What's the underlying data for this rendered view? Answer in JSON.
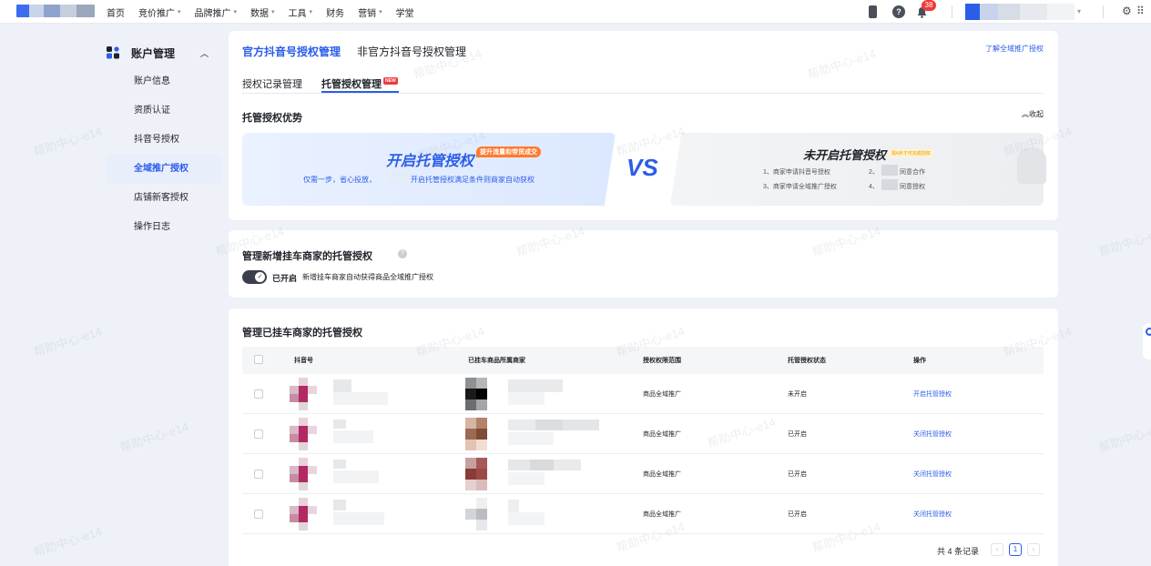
{
  "nav": {
    "items": [
      {
        "label": "首页",
        "caret": false
      },
      {
        "label": "竞价推广",
        "caret": true
      },
      {
        "label": "品牌推广",
        "caret": true
      },
      {
        "label": "数据",
        "caret": true
      },
      {
        "label": "工具",
        "caret": true
      },
      {
        "label": "财务",
        "caret": false
      },
      {
        "label": "营销",
        "caret": true
      },
      {
        "label": "学堂",
        "caret": false
      }
    ],
    "notification_count": "38"
  },
  "sidebar": {
    "title": "账户管理",
    "items": [
      {
        "label": "账户信息"
      },
      {
        "label": "资质认证"
      },
      {
        "label": "抖音号授权"
      },
      {
        "label": "全域推广授权",
        "active": true
      },
      {
        "label": "店铺新客授权"
      },
      {
        "label": "操作日志"
      }
    ]
  },
  "header": {
    "tab_official": "官方抖音号授权管理",
    "tab_unofficial": "非官方抖音号授权管理",
    "learn_link": "了解全域推广授权",
    "sub_tab_records": "授权记录管理",
    "sub_tab_hosted": "托管授权管理",
    "new_badge": "NEW"
  },
  "advantages": {
    "title": "托管授权优势",
    "collapse": "收起",
    "left_title": "开启托管授权",
    "left_badge": "提升流量和带货成交",
    "left_desc_a": "仅需一步，省心投放，",
    "left_desc_b": "开启托管授权满足条件则商家自动获权",
    "vs": "VS",
    "right_title": "未开启托管授权",
    "right_badge": "需4步才可完成授权",
    "right_steps": [
      "1、商家申请抖音号授权",
      "2、",
      "同意合作",
      "3、商家申请全域推广授权",
      "4、",
      "同意授权"
    ]
  },
  "new_merchants": {
    "title": "管理新增挂车商家的托管授权",
    "toggle_label": "已开启",
    "toggle_desc": "新增挂车商家自动获得商品全域推广授权"
  },
  "table_section": {
    "title": "管理已挂车商家的托管授权",
    "columns": [
      "抖音号",
      "已挂车商品所属商家",
      "授权权限范围",
      "托管授权状态",
      "操作"
    ],
    "rows": [
      {
        "scope": "商品全域推广",
        "status": "未开启",
        "action": "开启托管授权"
      },
      {
        "scope": "商品全域推广",
        "status": "已开启",
        "action": "关闭托管授权"
      },
      {
        "scope": "商品全域推广",
        "status": "已开启",
        "action": "关闭托管授权"
      },
      {
        "scope": "商品全域推广",
        "status": "已开启",
        "action": "关闭托管授权"
      }
    ],
    "pagination": {
      "total": "共 4 条记录",
      "current_page": "1"
    }
  },
  "watermark": "帮助中心-e14",
  "colors": {
    "primary": "#2b5de8",
    "toggle": "#3a3f4b",
    "badge_orange": "#ff7a2e",
    "badge_red": "#f03a3a"
  }
}
